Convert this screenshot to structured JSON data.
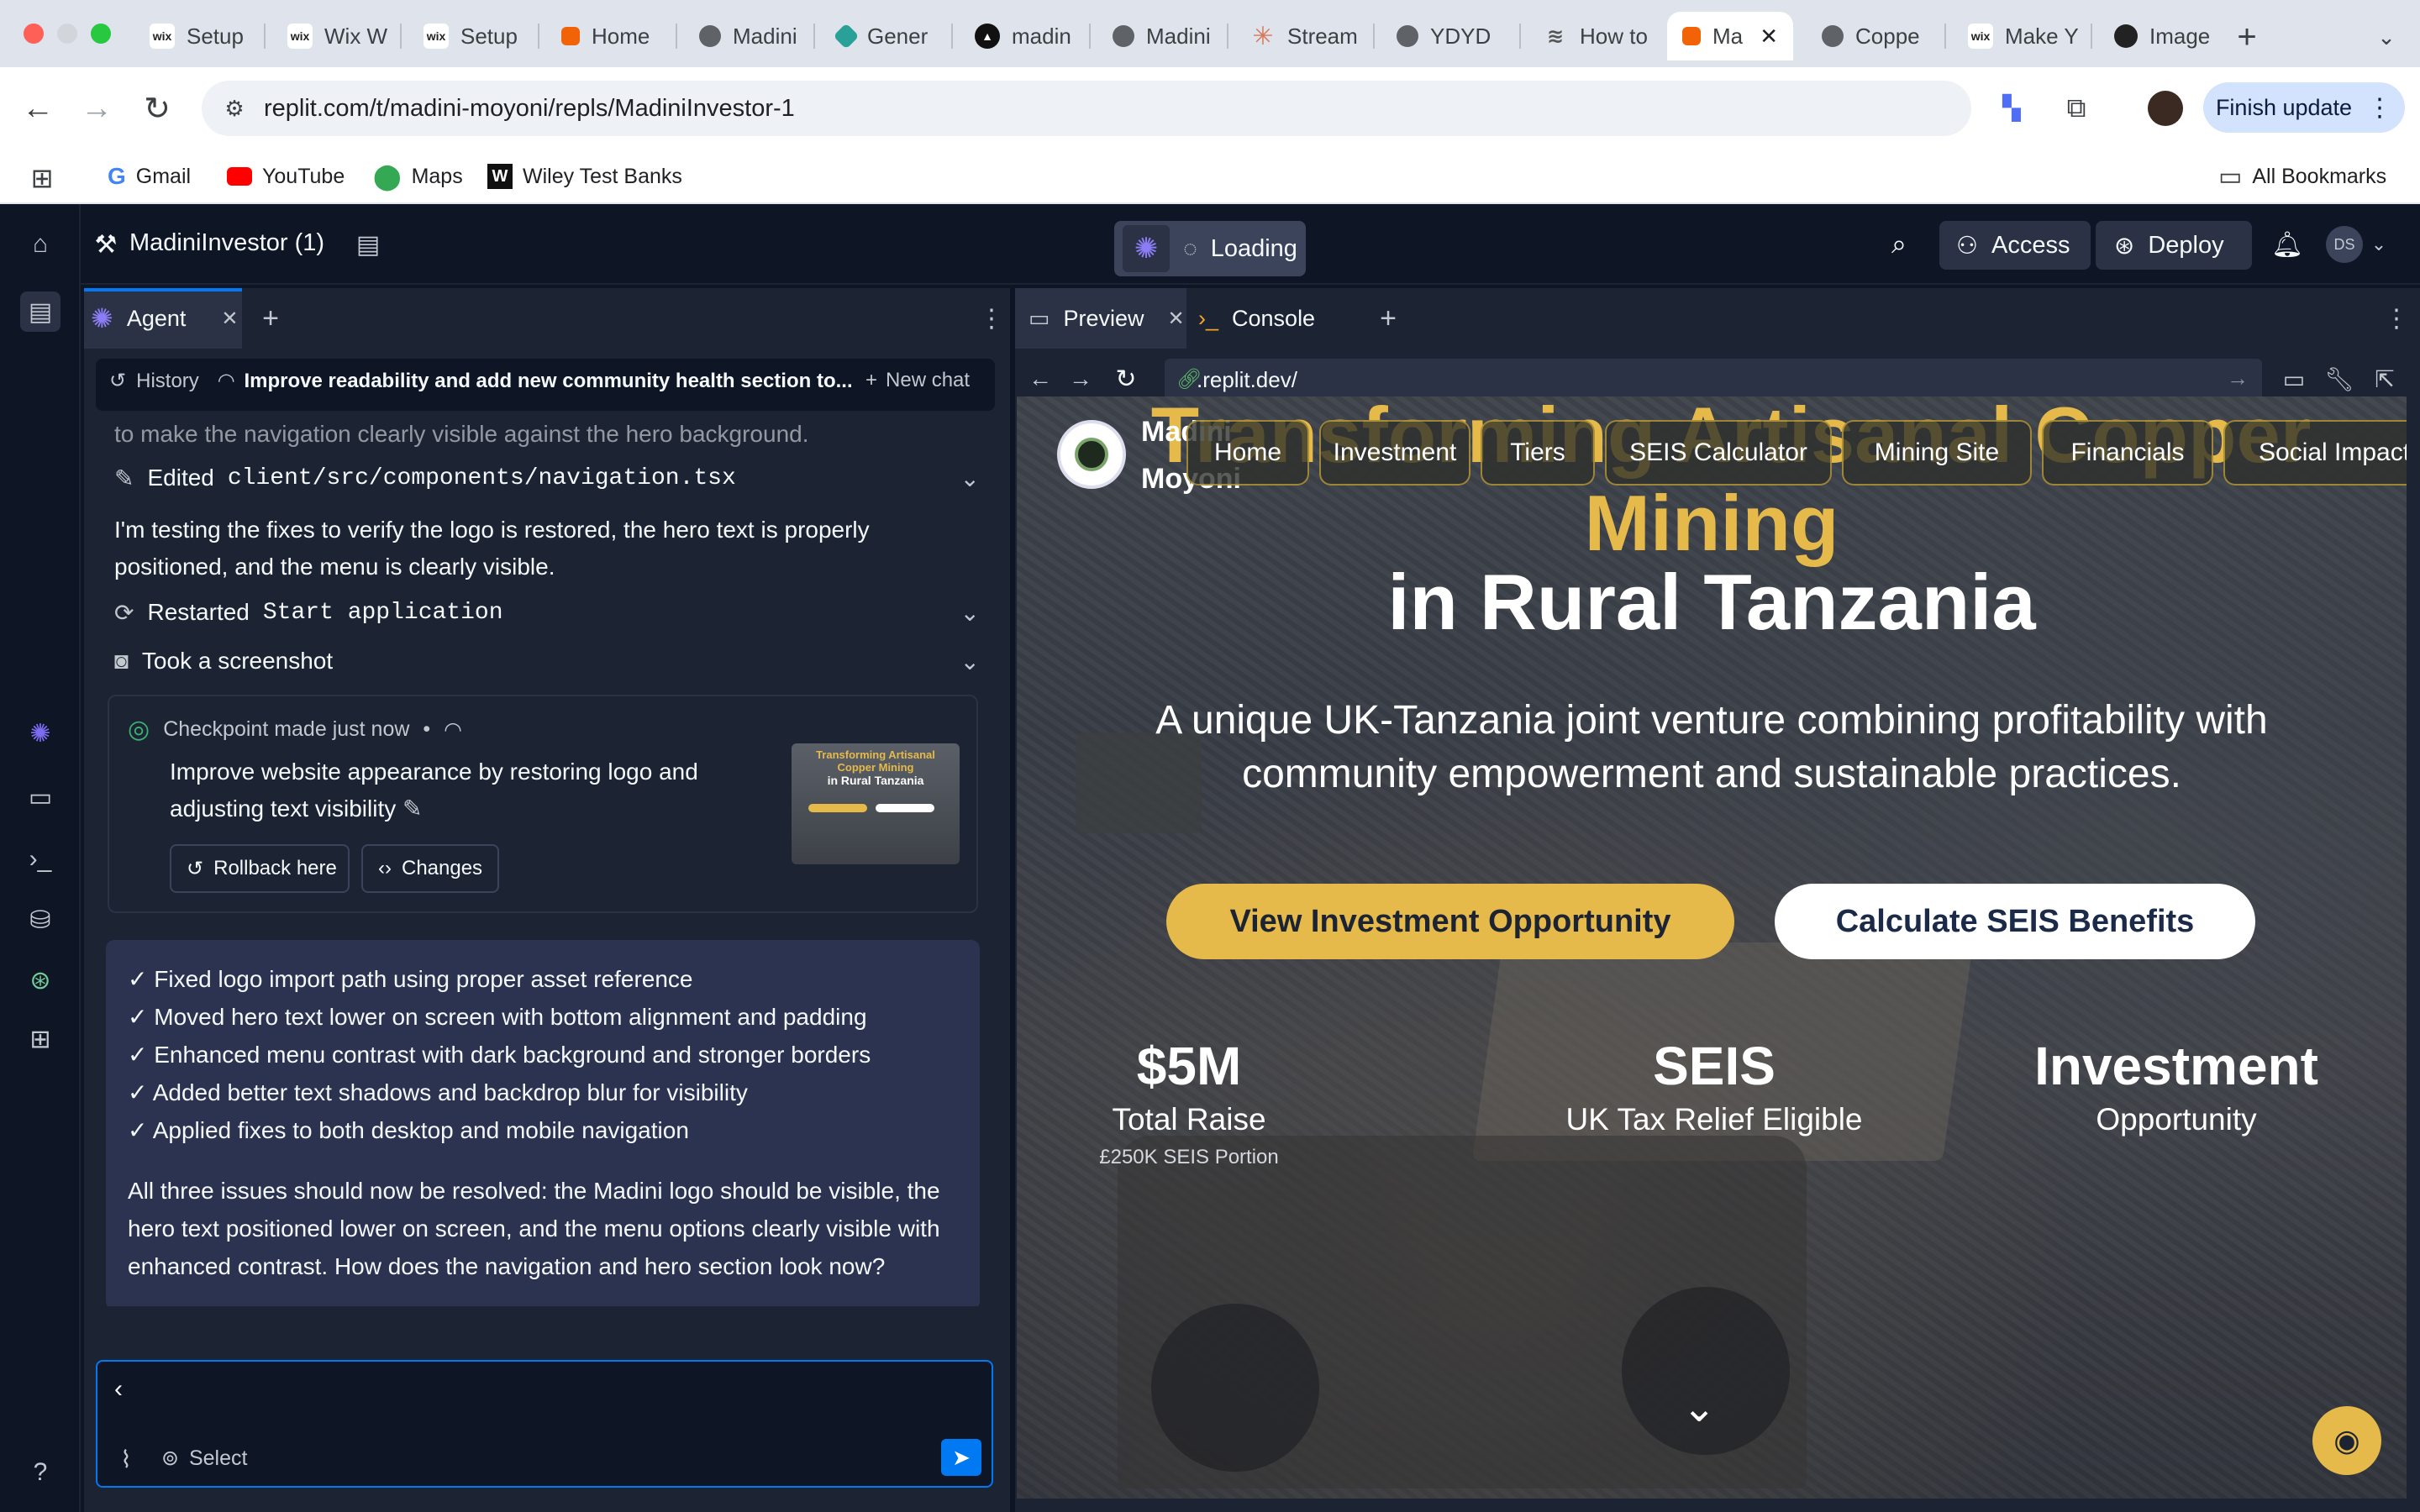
{
  "browser": {
    "tabs": [
      "Setup",
      "Wix W",
      "Setup",
      "Home",
      "Madini",
      "Gener",
      "madin",
      "Madini",
      "Stream",
      "YDYD",
      "How to",
      "Ma",
      "Coppe",
      "Make Y",
      "Image"
    ],
    "url": "replit.com/t/madini-moyoni/repls/MadiniInvestor-1",
    "finish_update": "Finish update",
    "bookmarks": [
      "Gmail",
      "YouTube",
      "Maps",
      "Wiley Test Banks"
    ],
    "all_bookmarks": "All Bookmarks"
  },
  "replit": {
    "project_name": "MadiniInvestor (1)",
    "loading": "Loading",
    "access": "Access",
    "deploy": "Deploy",
    "avatar_initials": "DS"
  },
  "agent": {
    "tab_label": "Agent",
    "history": "History",
    "chat_title": "Improve readability and add new community health section to...",
    "new_chat": "New chat",
    "cut_text": "to make the navigation clearly visible against the hero background.",
    "edited_label": "Edited",
    "edited_file": "client/src/components/navigation.tsx",
    "testing_text": "I'm testing the fixes to verify the logo is restored, the hero text is properly positioned, and the menu is clearly visible.",
    "restarted_label": "Restarted",
    "restarted_target": "Start application",
    "screenshot_label": "Took a screenshot",
    "checkpoint_title": "Checkpoint made just now",
    "checkpoint_desc": "Improve website appearance by restoring logo and adjusting text visibility",
    "rollback": "Rollback here",
    "changes": "Changes",
    "thumb_line1": "Transforming Artisanal",
    "thumb_line2": "Copper Mining",
    "thumb_line3": "in Rural Tanzania",
    "fixes": [
      "✓ Fixed logo import path using proper asset reference",
      "✓ Moved hero text lower on screen with bottom alignment and padding",
      "✓ Enhanced menu contrast with dark background and stronger borders",
      "✓ Added better text shadows and backdrop blur for visibility",
      "✓ Applied fixes to both desktop and mobile navigation"
    ],
    "summary": "All three issues should now be resolved: the Madini logo should be visible, the hero text positioned lower on screen, and the menu options clearly visible with enhanced contrast. How does the navigation and hero section look now?",
    "input_value": "‹",
    "select_label": "Select"
  },
  "preview": {
    "tab_preview": "Preview",
    "tab_console": "Console",
    "url": ".replit.dev/",
    "brand_line1": "Madini",
    "brand_line2": "Moyoni",
    "nav": [
      "Home",
      "Investment",
      "Tiers",
      "SEIS Calculator",
      "Mining Site",
      "Financials",
      "Social Impact"
    ],
    "hero_behind": "Transforming Artisanal Copper",
    "hero_mining": "Mining",
    "hero_line2": "in Rural Tanzania",
    "hero_sub": "A unique UK-Tanzania joint venture combining profitability with community empowerment and sustainable practices.",
    "cta_primary": "View Investment Opportunity",
    "cta_secondary": "Calculate SEIS Benefits",
    "stats": [
      {
        "big": "$5M",
        "label": "Total Raise",
        "note": "£250K SEIS Portion"
      },
      {
        "big": "SEIS",
        "label": "UK Tax Relief Eligible",
        "note": ""
      },
      {
        "big": "Investment",
        "label": "Opportunity",
        "note": ""
      }
    ]
  },
  "colors": {
    "accent_gold": "#e5b94a",
    "replit_bg": "#0e1525",
    "panel": "#1c2333",
    "send_blue": "#0079f2"
  }
}
